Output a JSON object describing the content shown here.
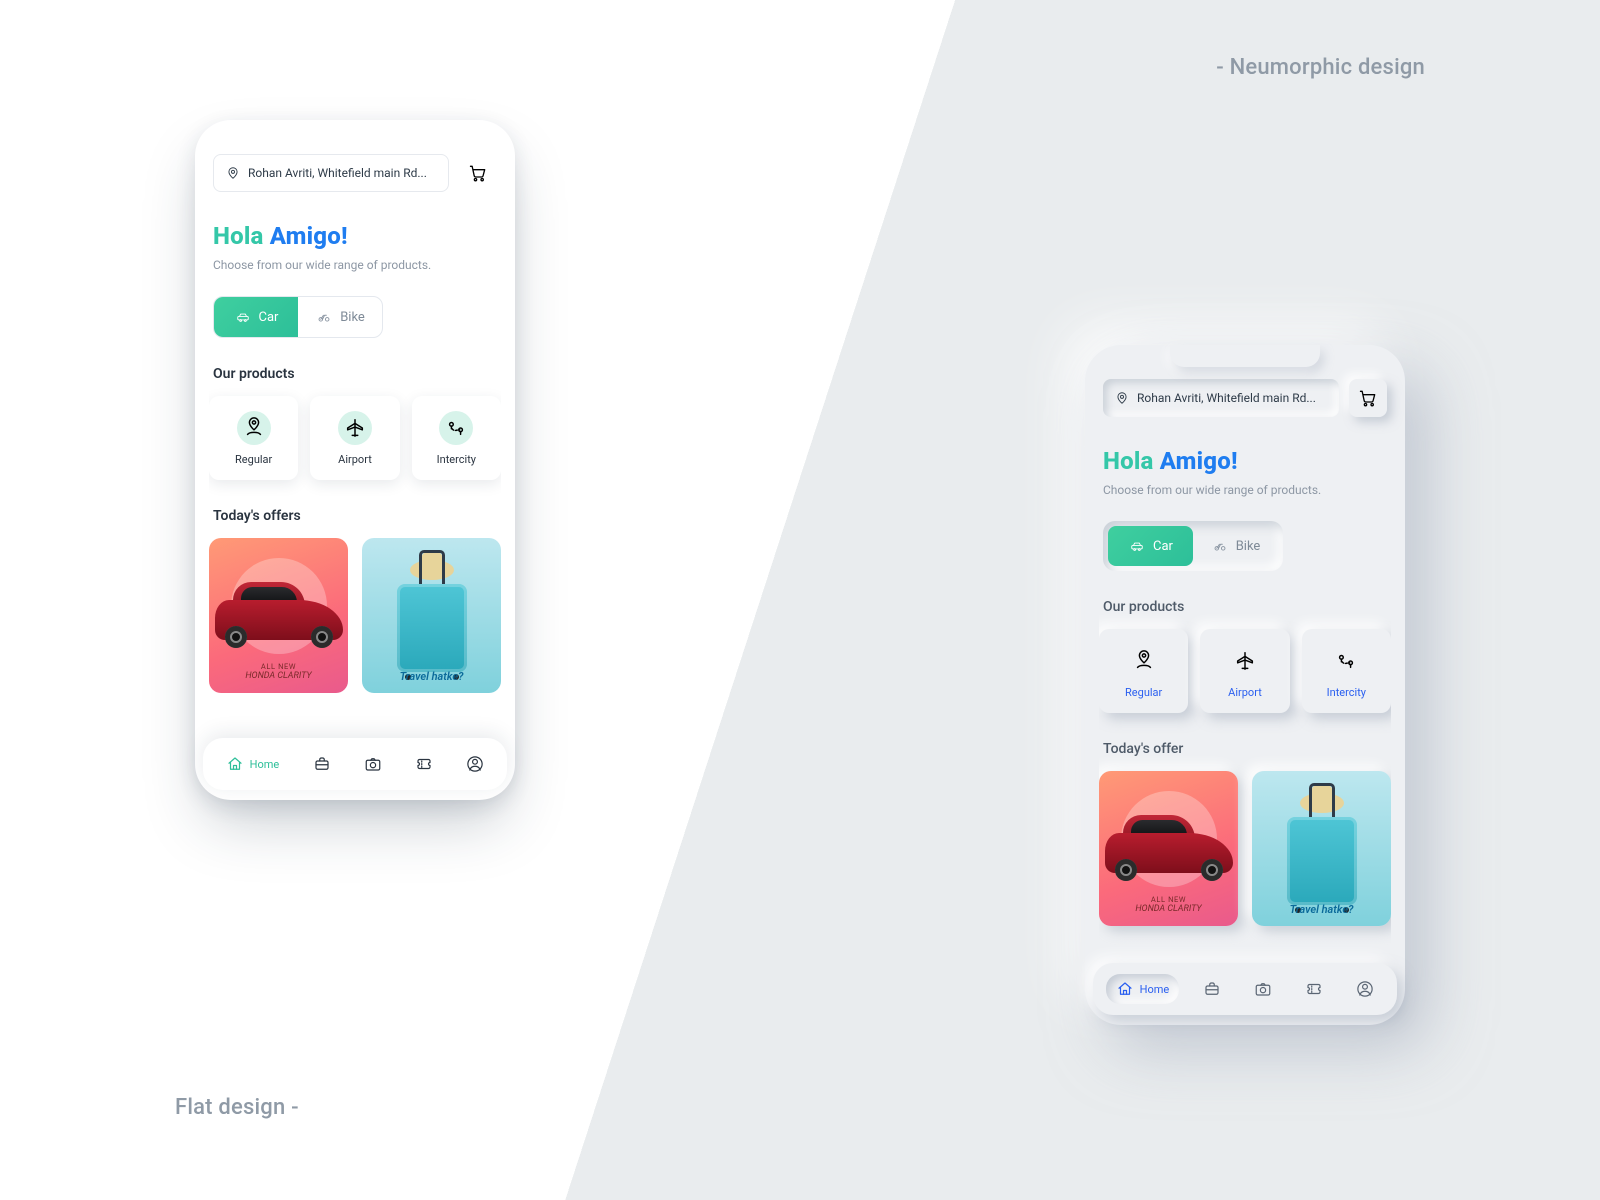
{
  "labels": {
    "flat": "Flat design -",
    "neum": "- Neumorphic design"
  },
  "location": "Rohan Avriti, Whitefield main Rd...",
  "greeting": {
    "hola": "Hola",
    "amigo": "Amigo!"
  },
  "subline": "Choose from our wide range of products.",
  "toggle": {
    "car": "Car",
    "bike": "Bike"
  },
  "sections": {
    "products": "Our products",
    "offers_flat": "Today's offers",
    "offers_neum": "Today's offer"
  },
  "products": [
    {
      "label": "Regular"
    },
    {
      "label": "Airport"
    },
    {
      "label": "Intercity"
    }
  ],
  "offers": {
    "car_sub": "ALL NEW",
    "car_title": "HONDA CLARITY",
    "travel": "Travel hatke?"
  },
  "tabs": {
    "home": "Home"
  }
}
